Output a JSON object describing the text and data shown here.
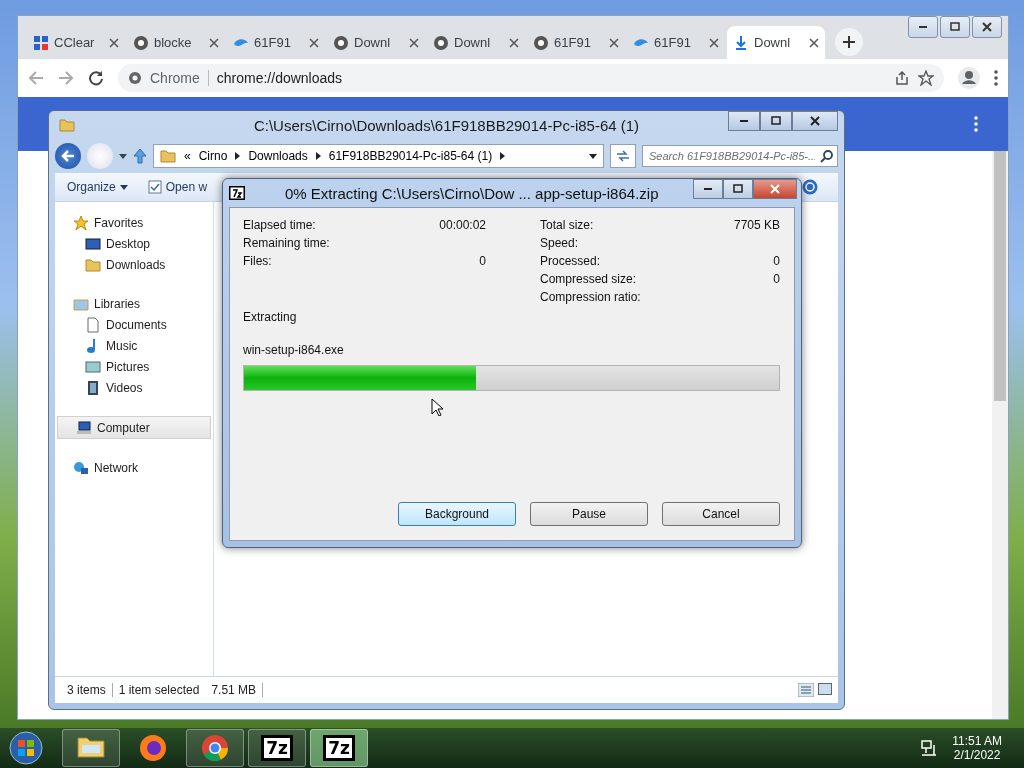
{
  "browser": {
    "tabs": [
      {
        "label": "CClear",
        "kind": "app",
        "selected": false
      },
      {
        "label": "blocke",
        "kind": "web",
        "selected": false
      },
      {
        "label": "61F91",
        "kind": "cloud",
        "selected": false
      },
      {
        "label": "Downl",
        "kind": "web",
        "selected": false
      },
      {
        "label": "Downl",
        "kind": "web",
        "selected": false
      },
      {
        "label": "61F91",
        "kind": "web",
        "selected": false
      },
      {
        "label": "61F91",
        "kind": "cloud",
        "selected": false
      },
      {
        "label": "Downl",
        "kind": "download",
        "selected": true
      }
    ],
    "site_label": "Chrome",
    "url": "chrome://downloads"
  },
  "explorer": {
    "title": "C:\\Users\\Cirno\\Downloads\\61F918BB29014-Pc-i85-64 (1)",
    "breadcrumb": [
      "«",
      "Cirno",
      "Downloads",
      "61F918BB29014-Pc-i85-64 (1)"
    ],
    "search": {
      "placeholder": "Search 61F918BB29014-Pc-i85-..."
    },
    "toolbar": [
      "Organize",
      "Open w"
    ],
    "sidebar": [
      {
        "label": "Favorites",
        "kind": "favorites",
        "selected": false,
        "children": [
          {
            "label": "Desktop",
            "kind": "desktop",
            "selected": false
          },
          {
            "label": "Downloads",
            "kind": "downloads",
            "selected": false
          }
        ]
      },
      {
        "label": "Libraries",
        "kind": "libraries",
        "selected": false,
        "children": [
          {
            "label": "Documents",
            "kind": "documents",
            "selected": false
          },
          {
            "label": "Music",
            "kind": "music",
            "selected": false
          },
          {
            "label": "Pictures",
            "kind": "pictures",
            "selected": false
          },
          {
            "label": "Videos",
            "kind": "videos",
            "selected": false
          }
        ]
      },
      {
        "label": "Computer",
        "kind": "computer",
        "selected": true
      },
      {
        "label": "Network",
        "kind": "network",
        "selected": false
      }
    ],
    "status_bar": [
      "3 items",
      "1 item selected",
      "7.51 MB"
    ]
  },
  "dialog": {
    "title": "0% Extracting C:\\Users\\Cirno\\Dow ... app-setup-i864.zip",
    "left_stats": [
      {
        "label": "Elapsed time:",
        "value": "00:00:02"
      },
      {
        "label": "Remaining time:"
      },
      {
        "label": "Files:",
        "value": "0"
      }
    ],
    "right_stats": [
      {
        "label": "Total size:",
        "value": "7705 KB"
      },
      {
        "label": "Speed:"
      },
      {
        "label": "Processed:",
        "value": "0"
      },
      {
        "label": "Compressed size:",
        "value": "0"
      },
      {
        "label": "Compression ratio:"
      }
    ],
    "action": "Extracting",
    "file": "win-setup-i864.exe",
    "progress": {
      "level": 0.434
    },
    "buttons": [
      {
        "label": "Background",
        "selected": true
      },
      {
        "label": "Pause",
        "selected": false
      },
      {
        "label": "Cancel",
        "selected": false
      }
    ]
  },
  "taskbar": {
    "items": [
      {
        "kind": "explorer",
        "selected": false
      },
      {
        "kind": "firefox",
        "selected": false
      },
      {
        "kind": "chrome",
        "selected": false
      },
      {
        "kind": "sevenzip",
        "label": "7z",
        "selected": false
      },
      {
        "kind": "sevenzip",
        "label": "7z",
        "selected": true
      }
    ],
    "time": "11:51 AM",
    "date": "2/1/2022"
  }
}
